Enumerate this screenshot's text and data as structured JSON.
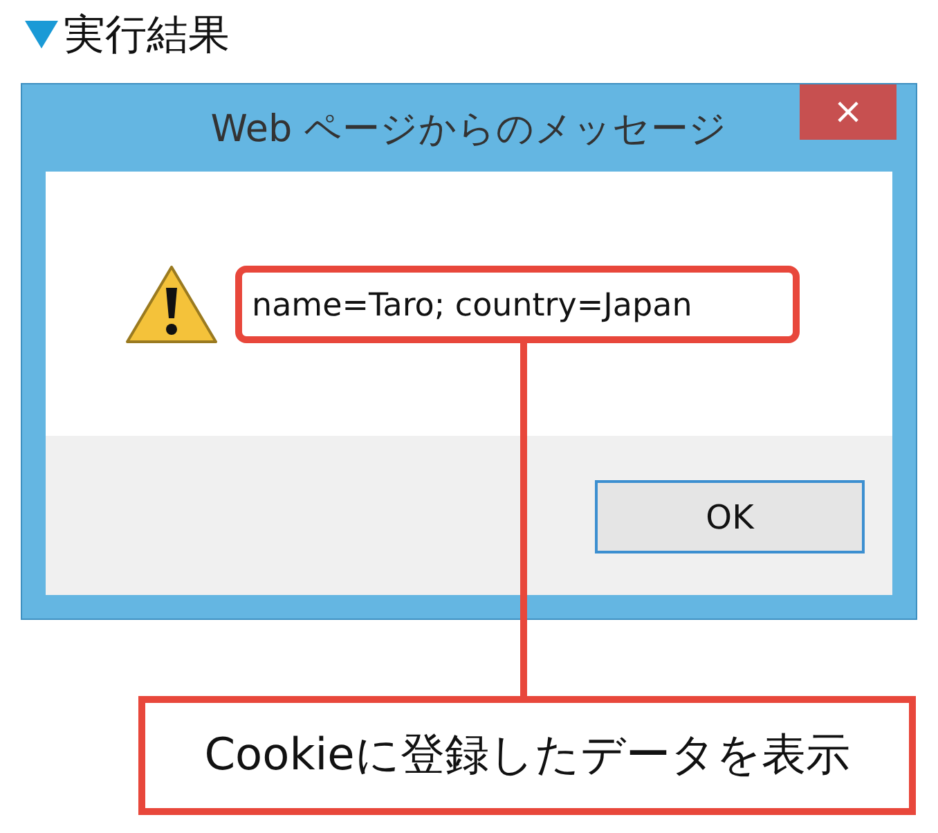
{
  "heading": {
    "text": "実行結果"
  },
  "dialog": {
    "title": "Web ページからのメッセージ",
    "close": "×",
    "message": "name=Taro; country=Japan",
    "buttons": [
      {
        "label": "OK"
      }
    ]
  },
  "callout": {
    "text": "Cookieに登録したデータを表示"
  }
}
